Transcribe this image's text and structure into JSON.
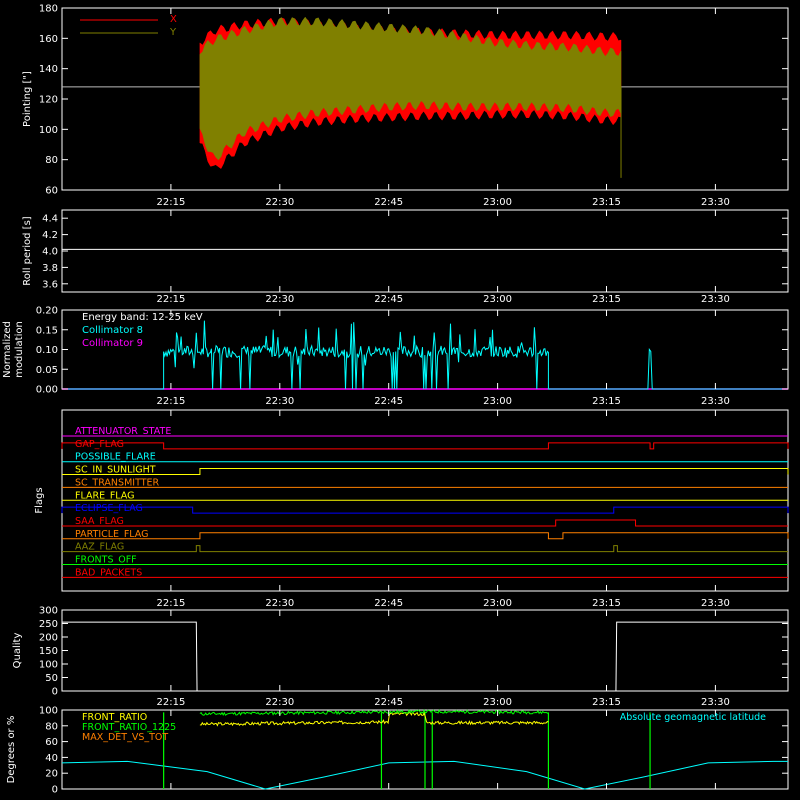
{
  "chart_data": [
    {
      "type": "area",
      "ylabel": "Pointing [\"]",
      "ylim": [
        60,
        180
      ],
      "yticks": [
        "60",
        "80",
        "100",
        "120",
        "140",
        "160",
        "180"
      ],
      "xticks": [
        "22:15",
        "22:30",
        "22:45",
        "23:00",
        "23:15",
        "23:30"
      ],
      "legend": [
        {
          "name": "X",
          "color": "#ff0000"
        },
        {
          "name": "Y",
          "color": "#808000"
        }
      ],
      "reference_line": 128,
      "series": [
        {
          "name": "X",
          "color": "#ff0000",
          "x": [
            "22:19",
            "22:21",
            "22:25",
            "22:30",
            "22:35",
            "22:40",
            "22:45",
            "22:50",
            "22:55",
            "23:00",
            "23:05",
            "23:10",
            "23:15",
            "23:17"
          ],
          "upper": [
            160,
            168,
            172,
            174,
            172,
            170,
            168,
            167,
            166,
            165,
            165,
            165,
            164,
            164
          ],
          "lower": [
            88,
            70,
            88,
            98,
            102,
            104,
            105,
            106,
            106,
            107,
            107,
            106,
            103,
            103
          ]
        },
        {
          "name": "Y",
          "color": "#808000",
          "x": [
            "22:19",
            "22:21",
            "22:25",
            "22:30",
            "22:35",
            "22:40",
            "22:45",
            "22:50",
            "22:55",
            "23:00",
            "23:05",
            "23:10",
            "23:15",
            "23:17"
          ],
          "upper": [
            155,
            162,
            168,
            174,
            174,
            172,
            170,
            168,
            164,
            160,
            158,
            157,
            154,
            154
          ],
          "lower": [
            95,
            77,
            95,
            104,
            108,
            110,
            112,
            113,
            112,
            112,
            112,
            111,
            108,
            108
          ]
        }
      ]
    },
    {
      "type": "line",
      "ylabel": "Roll period [s]",
      "ylim": [
        3.5,
        4.5
      ],
      "yticks": [
        "3.6",
        "3.8",
        "4.0",
        "4.2",
        "4.4"
      ],
      "xticks": [
        "22:15",
        "22:30",
        "22:45",
        "23:00",
        "23:15",
        "23:30"
      ],
      "series": [
        {
          "name": "",
          "color": "#ffffff",
          "x": [
            "22:00",
            "23:40"
          ],
          "values": [
            4.02,
            4.02
          ]
        }
      ]
    },
    {
      "type": "line",
      "ylabel_lines": [
        "Normalized",
        "modulation"
      ],
      "ylim": [
        0,
        0.2
      ],
      "yticks": [
        "0.00",
        "0.05",
        "0.10",
        "0.15",
        "0.20"
      ],
      "xticks": [
        "22:15",
        "22:30",
        "22:45",
        "23:00",
        "23:15",
        "23:30"
      ],
      "legend_title": "Energy band: 12-25 keV",
      "legend": [
        {
          "name": "Collimator 8",
          "color": "#00ffff"
        },
        {
          "name": "Collimator 9",
          "color": "#ff00ff"
        }
      ],
      "series": [
        {
          "name": "Collimator 8",
          "color": "#00ffff",
          "start": "22:14",
          "end": "23:07",
          "mean": 0.095,
          "segment_end": "23:07",
          "burst": {
            "at": "23:21",
            "value": 0.1
          }
        },
        {
          "name": "Collimator 9",
          "color": "#ff00ff",
          "baseline": 0.0
        }
      ]
    },
    {
      "type": "line",
      "ylabel": "Flags",
      "xticks": [
        "22:15",
        "22:30",
        "22:45",
        "23:00",
        "23:15",
        "23:30"
      ],
      "flags": [
        {
          "name": "ATTENUATOR_STATE",
          "color": "#ff00ff",
          "on": []
        },
        {
          "name": "GAP_FLAG",
          "color": "#ff0000",
          "on": [
            [
              "22:00",
              "22:14"
            ],
            [
              "23:07",
              "23:21"
            ],
            [
              "23:21.5",
              "23:40"
            ]
          ]
        },
        {
          "name": "POSSIBLE_FLARE",
          "color": "#00ffff",
          "on": []
        },
        {
          "name": "SC_IN_SUNLIGHT",
          "color": "#ffff00",
          "on": [
            [
              "22:19",
              "23:40"
            ]
          ]
        },
        {
          "name": "SC_TRANSMITTER",
          "color": "#ff8000",
          "on": []
        },
        {
          "name": "FLARE_FLAG",
          "color": "#ffff00",
          "on": []
        },
        {
          "name": "ECLIPSE_FLAG",
          "color": "#0000ff",
          "on": [
            [
              "22:00",
              "22:18"
            ],
            [
              "23:16",
              "23:40"
            ]
          ]
        },
        {
          "name": "SAA_FLAG",
          "color": "#ff0000",
          "on": [
            [
              "23:08",
              "23:19"
            ]
          ]
        },
        {
          "name": "PARTICLE_FLAG",
          "color": "#ff8000",
          "on": [
            [
              "22:19",
              "23:07"
            ],
            [
              "23:09",
              "23:40"
            ]
          ]
        },
        {
          "name": "AAZ_FLAG",
          "color": "#808000",
          "on": [
            [
              "22:18.5",
              "22:19"
            ],
            [
              "23:16",
              "23:16.5"
            ]
          ]
        },
        {
          "name": "FRONTS_OFF",
          "color": "#00ff00",
          "on": []
        },
        {
          "name": "BAD_PACKETS",
          "color": "#ff0000",
          "on": []
        }
      ]
    },
    {
      "type": "line",
      "ylabel": "Quality",
      "ylim": [
        0,
        300
      ],
      "yticks": [
        "0",
        "50",
        "100",
        "150",
        "200",
        "250",
        "300"
      ],
      "xticks": [
        "22:15",
        "22:30",
        "22:45",
        "23:00",
        "23:15",
        "23:30"
      ],
      "series": [
        {
          "name": "",
          "color": "#ffffff",
          "x": [
            "22:00",
            "22:18.5",
            "22:18.6",
            "23:16.3",
            "23:16.4",
            "23:40"
          ],
          "values": [
            255,
            255,
            0,
            0,
            255,
            255
          ]
        }
      ]
    },
    {
      "type": "line",
      "ylabel": "Degrees or %",
      "ylim": [
        0,
        100
      ],
      "yticks": [
        "0",
        "20",
        "40",
        "60",
        "80",
        "100"
      ],
      "xticks": [
        "22:15",
        "22:30",
        "22:45",
        "23:00",
        "23:15",
        "23:30"
      ],
      "legend": [
        {
          "name": "FRONT_RATIO",
          "color": "#ffff00"
        },
        {
          "name": "FRONT_RATIO_1225",
          "color": "#00ff00"
        },
        {
          "name": "MAX_DET_VS_TOT",
          "color": "#ff8000"
        }
      ],
      "annotation": {
        "text": "Absolute geomagnetic latitude",
        "color": "#00ffff"
      },
      "series": [
        {
          "name": "FRONT_RATIO",
          "color": "#ffff00",
          "x": [
            "22:19",
            "22:45",
            "22:45.1",
            "22:50",
            "22:50.1",
            "23:07"
          ],
          "values": [
            82,
            85,
            95,
            95,
            84,
            84
          ]
        },
        {
          "name": "FRONT_RATIO_1225",
          "color": "#00ff00",
          "x": [
            "22:19",
            "22:50",
            "23:07"
          ],
          "values": [
            95,
            98,
            97
          ],
          "drops": [
            "22:14",
            "22:44",
            "22:50",
            "22:51",
            "23:07",
            "23:21"
          ]
        },
        {
          "name": "Absolute geomagnetic latitude",
          "color": "#00ffff",
          "x": [
            "22:00",
            "22:09",
            "22:20",
            "22:28",
            "22:36",
            "22:45",
            "22:54",
            "23:04",
            "23:12",
            "23:20",
            "23:29",
            "23:38",
            "23:40"
          ],
          "values": [
            33,
            35,
            22,
            0,
            15,
            33,
            35,
            22,
            0,
            15,
            33,
            35,
            35
          ]
        }
      ]
    }
  ]
}
